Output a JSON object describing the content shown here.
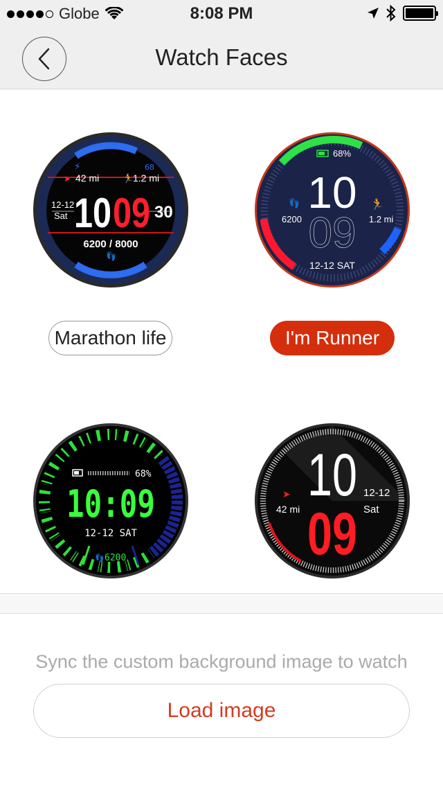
{
  "status_bar": {
    "carrier": "Globe",
    "time": "8:08 PM"
  },
  "nav": {
    "title": "Watch Faces"
  },
  "faces": [
    {
      "label": "Marathon life",
      "selected": false,
      "display": {
        "distance": "42 mi",
        "pace": "1.2 mi",
        "battery": "68",
        "date": "12-12",
        "day": "Sat",
        "hour": "10",
        "minute": "09",
        "second": "30",
        "steps": "6200 / 8000"
      }
    },
    {
      "label": "I'm Runner",
      "selected": true,
      "display": {
        "battery": "68%",
        "hour": "10",
        "minute": "09",
        "steps": "6200",
        "distance": "1.2 mi",
        "date": "12-12 SAT"
      }
    },
    {
      "label": "",
      "display": {
        "battery": "68%",
        "time": "10:09",
        "date": "12-12 SAT",
        "steps": "6200"
      }
    },
    {
      "label": "",
      "display": {
        "hour": "10",
        "minute": "09",
        "distance": "42 mi",
        "date": "12-12",
        "day": "Sat"
      }
    }
  ],
  "sync": {
    "description": "Sync the custom background image to watch",
    "button_label": "Load image"
  },
  "colors": {
    "accent": "#d52e0c",
    "load_text": "#d53a21"
  }
}
